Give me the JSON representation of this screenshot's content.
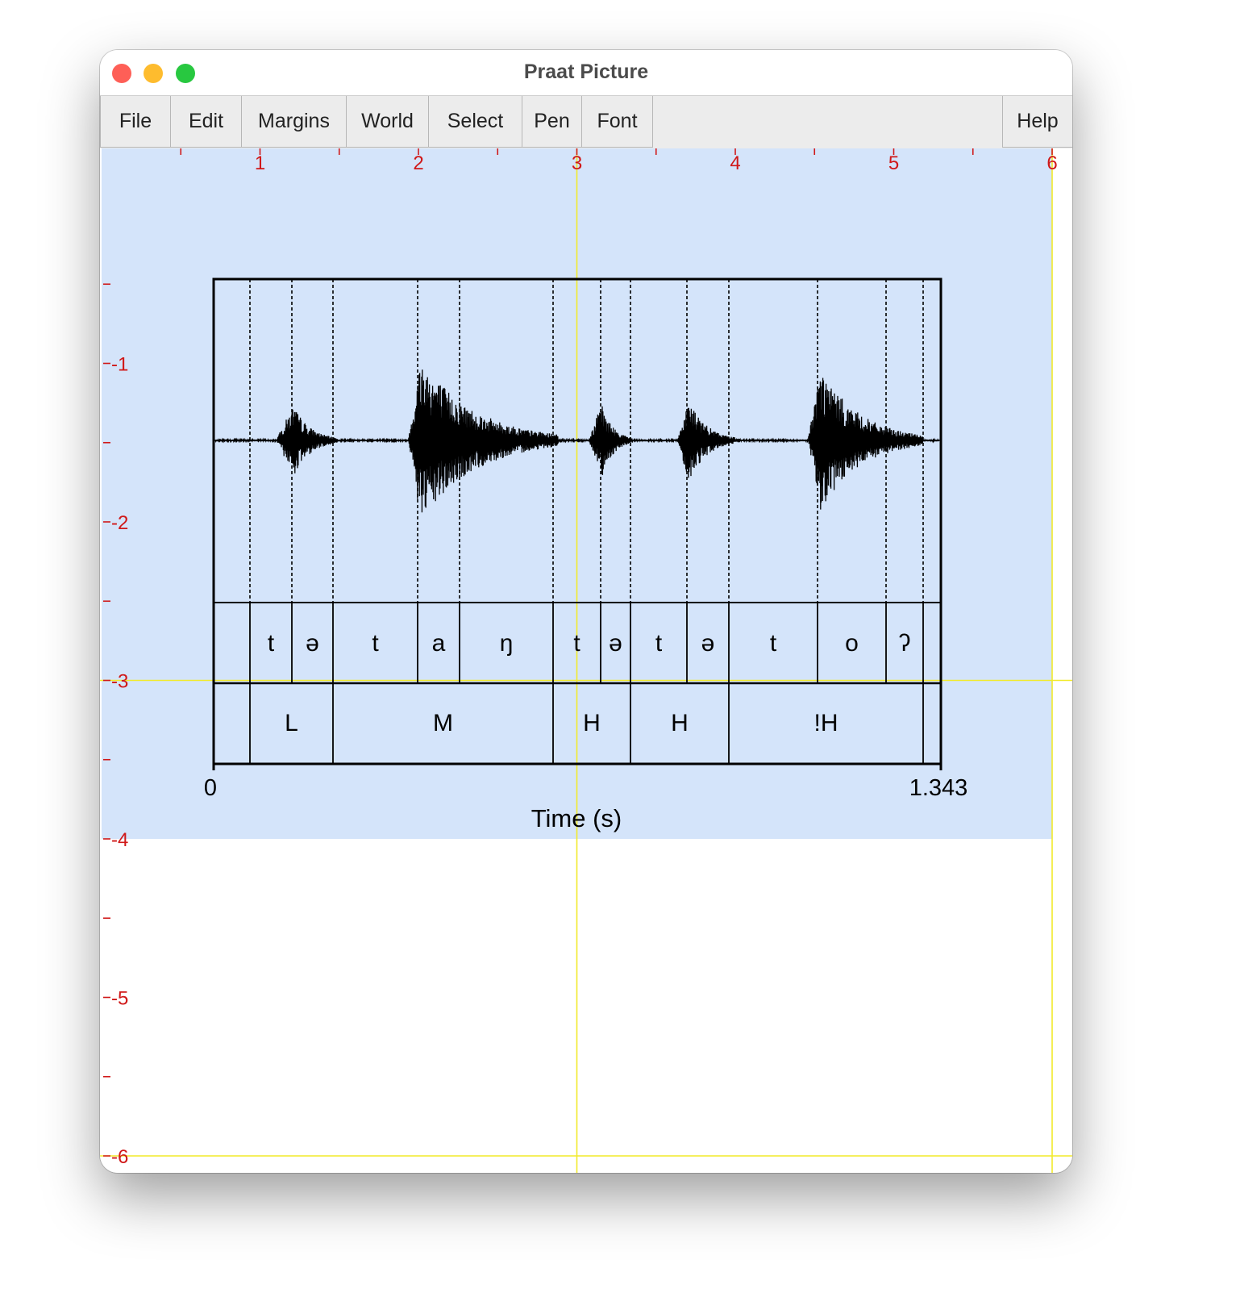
{
  "window": {
    "title": "Praat Picture"
  },
  "menu": {
    "items": [
      {
        "id": "file",
        "label": "File"
      },
      {
        "id": "edit",
        "label": "Edit"
      },
      {
        "id": "margins",
        "label": "Margins"
      },
      {
        "id": "world",
        "label": "World"
      },
      {
        "id": "select",
        "label": "Select"
      },
      {
        "id": "pen",
        "label": "Pen"
      },
      {
        "id": "font",
        "label": "Font"
      }
    ],
    "help": "Help"
  },
  "ruler": {
    "inch_labels_x": [
      "1",
      "2",
      "3",
      "4",
      "5",
      "6"
    ],
    "inch_labels_y": [
      "-1",
      "-2",
      "-3",
      "-4",
      "-5",
      "-6"
    ],
    "color": "#d01818"
  },
  "selection": {
    "x_inches": [
      0,
      6
    ],
    "y_inches": [
      0,
      -4
    ],
    "color": "#d4e4fa"
  },
  "crosshair": {
    "x_inches": [
      3,
      6
    ],
    "y_inches": [
      -3,
      -6
    ],
    "color": "#f2ea2a"
  },
  "textgrid": {
    "time_min": "0",
    "time_max": "1.343",
    "xlabel": "Time (s)",
    "tier1": [
      "t",
      "ə",
      "t",
      "a",
      "ŋ",
      "t",
      "ə",
      "t",
      "ə",
      "t",
      "o",
      "ʔ"
    ],
    "tier2": [
      "L",
      "M",
      "H",
      "H",
      "!H"
    ]
  }
}
